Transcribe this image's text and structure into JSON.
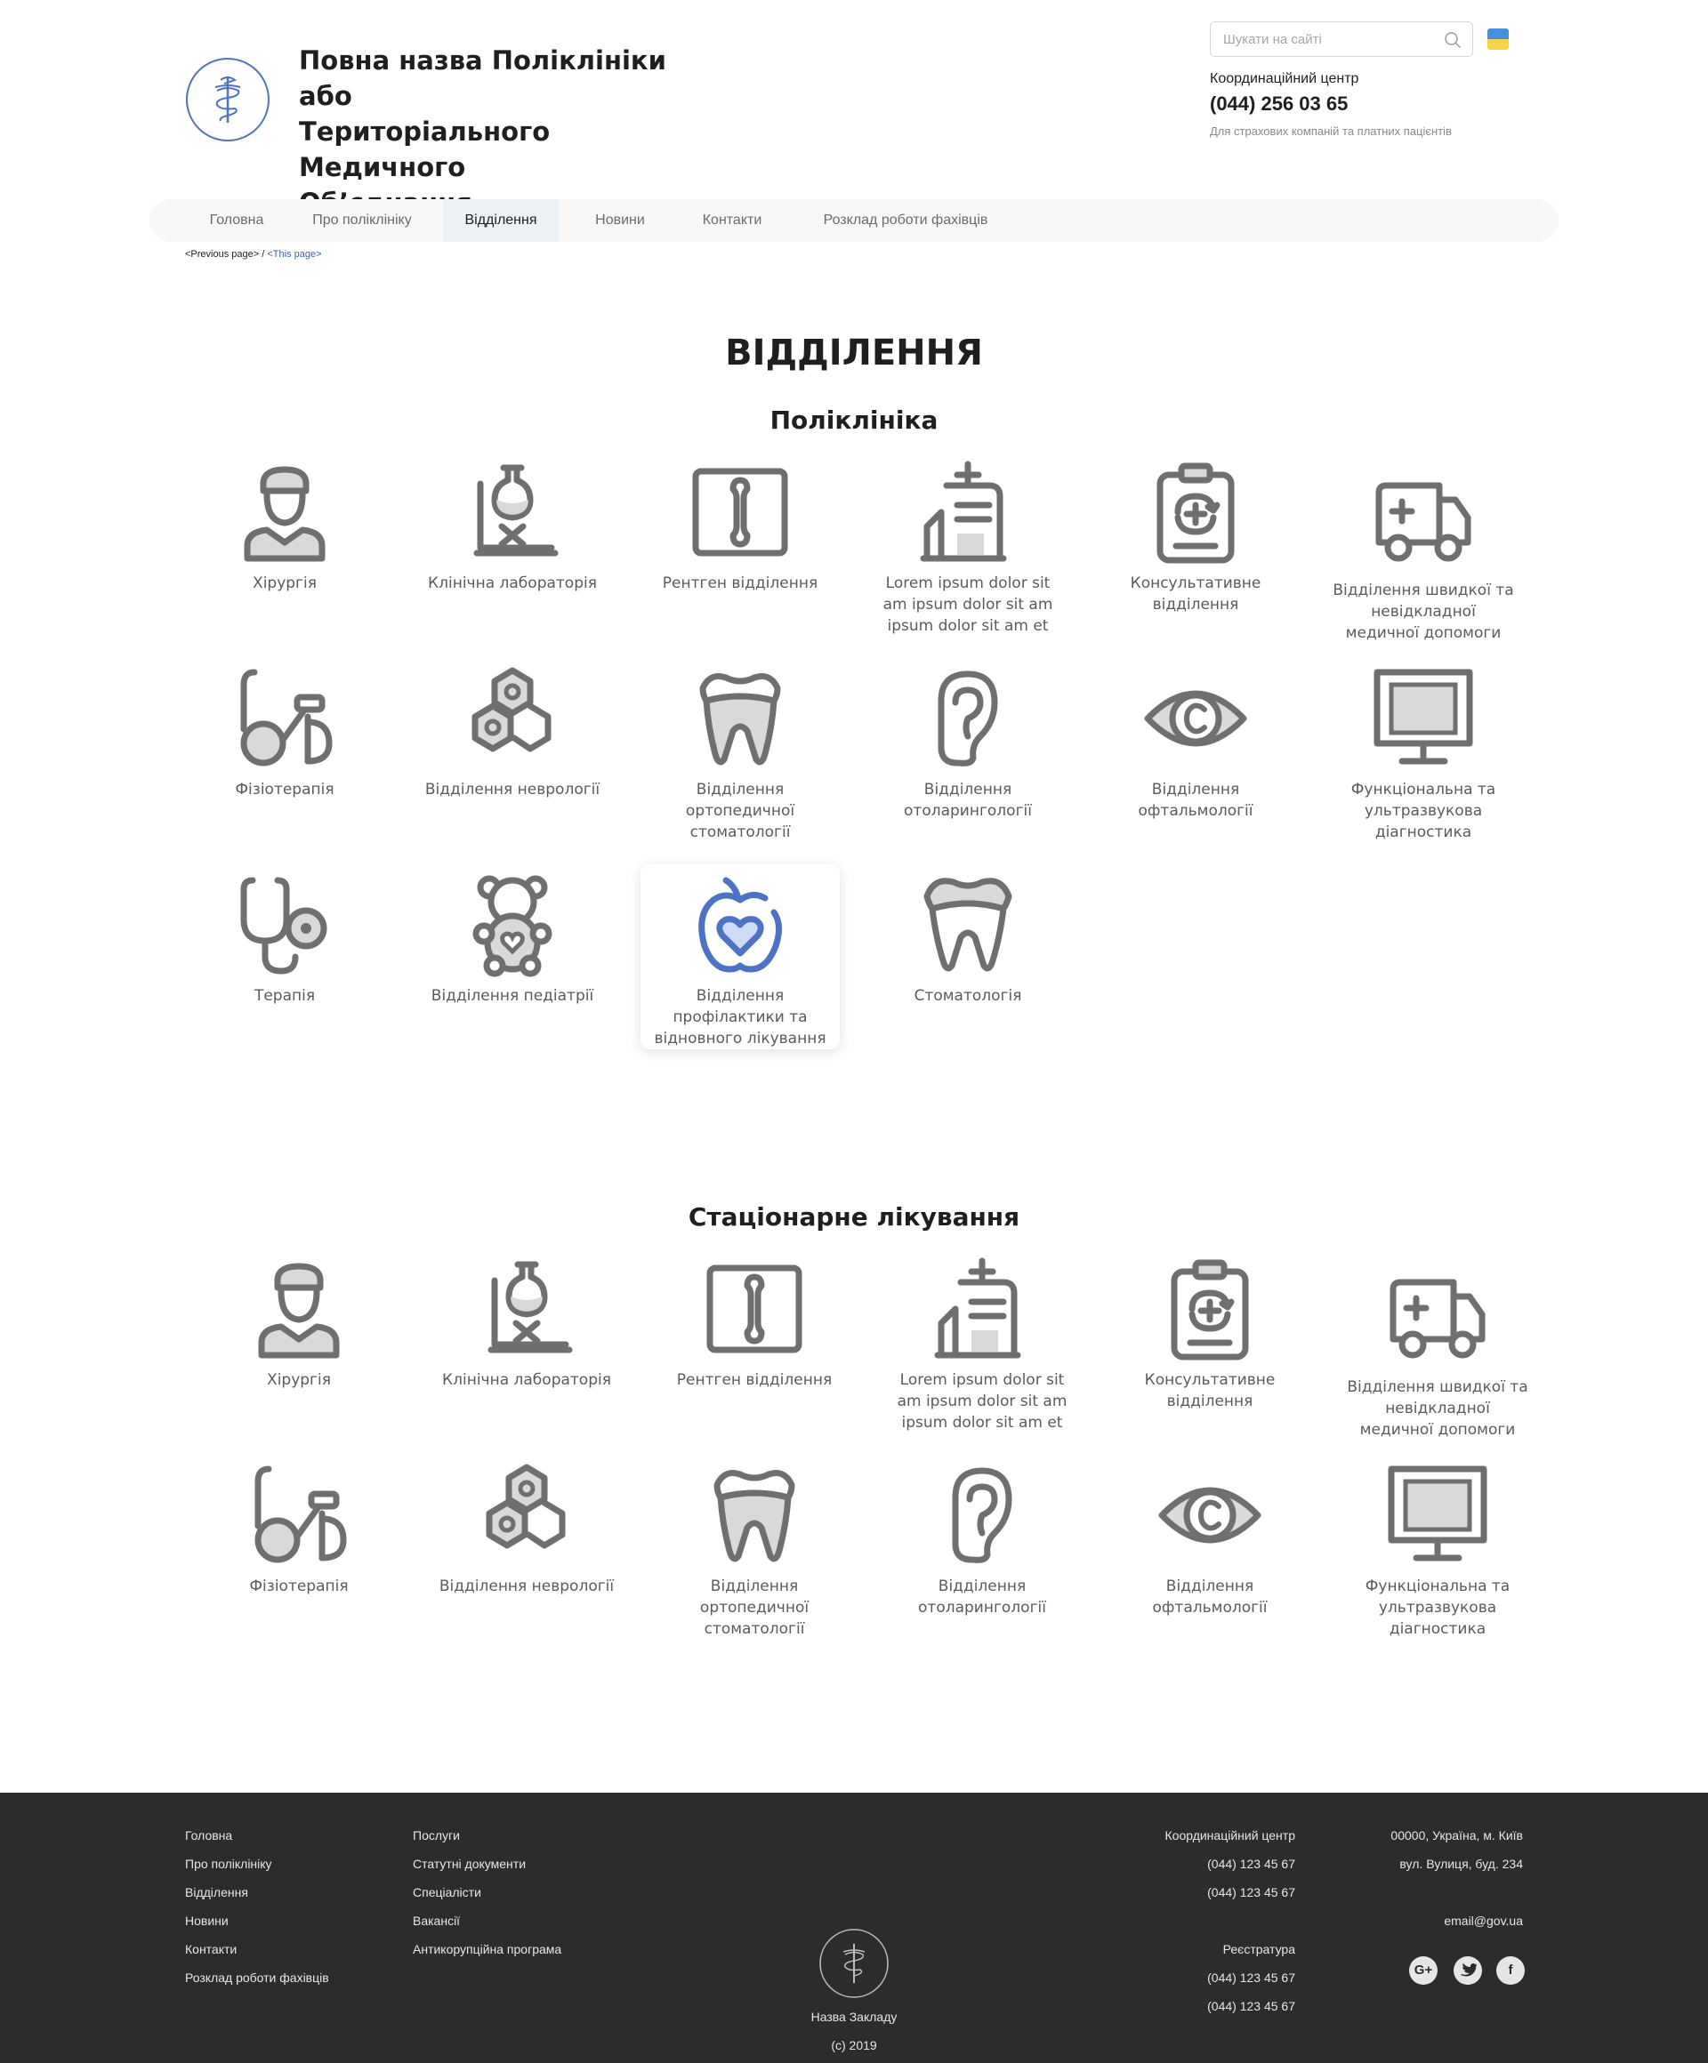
{
  "header": {
    "org_title": "Повна назва Поліклініки або\nТериторіального Медичного\nОб’єднання",
    "search_placeholder": "Шукати на сайті",
    "contact_title": "Координаційний центр",
    "contact_phone": "(044) 256 03 65",
    "contact_note": "Для страхових компаній та платних пацієнтів",
    "flag_colors": [
      "#4a8fdb",
      "#f5d547"
    ]
  },
  "nav": {
    "items": [
      "Головна",
      "Про поліклініку",
      "Відділення",
      "Новини",
      "Контакти",
      "Розклад роботи фахівців"
    ],
    "active": "Відділення"
  },
  "breadcrumb": {
    "previous": "<Previous page>",
    "separator": " / ",
    "current": "<This page>"
  },
  "page_title": "ВІДДІЛЕННЯ",
  "sections": [
    {
      "title": "Поліклініка",
      "departments": [
        {
          "icon": "surgeon-icon",
          "label": "Хірургія"
        },
        {
          "icon": "lab-flask-icon",
          "label": "Клінічна лабораторія"
        },
        {
          "icon": "xray-bone-icon",
          "label": "Рентген відділення"
        },
        {
          "icon": "medical-clipboard-icon",
          "label": "Lorem ipsum dolor sit am  ipsum dolor sit am ipsum dolor sit am et"
        },
        {
          "icon": "consultation-clipboard-icon",
          "label": "Консультативне відділення"
        },
        {
          "icon": "ambulance-icon",
          "label": "Відділення швидкої та невідкладної медичної допомоги"
        },
        {
          "icon": "exercise-bike-icon",
          "label": "Фізіотерапія"
        },
        {
          "icon": "molecule-icon",
          "label": "Відділення неврології"
        },
        {
          "icon": "tooth-crown-icon",
          "label": "Відділення ортопедичної стоматології"
        },
        {
          "icon": "ear-icon",
          "label": "Відділення отоларингології"
        },
        {
          "icon": "eye-icon",
          "label": "Відділення офтальмології"
        },
        {
          "icon": "monitor-icon",
          "label": "Функціональна та ультразвукова діагностика"
        },
        {
          "icon": "stethoscope-icon",
          "label": "Терапія"
        },
        {
          "icon": "teddy-bear-icon",
          "label": "Відділення педіатрії"
        },
        {
          "icon": "apple-heart-icon",
          "label": "Відділення профілактики та відновного лікування",
          "highlighted": true
        },
        {
          "icon": "tooth-icon",
          "label": "Стоматологія"
        }
      ]
    },
    {
      "title": "Стаціонарне лікування",
      "departments": [
        {
          "icon": "surgeon-icon",
          "label": "Хірургія"
        },
        {
          "icon": "lab-flask-icon",
          "label": "Клінічна лабораторія"
        },
        {
          "icon": "xray-bone-icon",
          "label": "Рентген відділення"
        },
        {
          "icon": "medical-clipboard-icon",
          "label": "Lorem ipsum dolor sit am  ipsum dolor sit am ipsum dolor sit am et"
        },
        {
          "icon": "consultation-clipboard-icon",
          "label": "Консультативне відділення"
        },
        {
          "icon": "ambulance-icon",
          "label": "Відділення швидкої та невідкладної медичної допомоги"
        },
        {
          "icon": "exercise-bike-icon",
          "label": "Фізіотерапія"
        },
        {
          "icon": "molecule-icon",
          "label": "Відділення неврології"
        },
        {
          "icon": "tooth-crown-icon",
          "label": "Відділення ортопедичної стоматології"
        },
        {
          "icon": "ear-icon",
          "label": "Відділення отоларингології"
        },
        {
          "icon": "eye-icon",
          "label": "Відділення офтальмології"
        },
        {
          "icon": "monitor-icon",
          "label": "Функціональна та ультразвукова діагностика"
        }
      ]
    }
  ],
  "footer": {
    "col1": [
      "Головна",
      "Про поліклініку",
      "Відділення",
      "Новини",
      "Контакти",
      "Розклад роботи фахівців"
    ],
    "col2": [
      "Послуги",
      "Статутні документи",
      "Спеціалісти",
      "Вакансії",
      "Антикорупційна програма"
    ],
    "coord_title": "Координаційний центр",
    "coord_phones": [
      "(044) 123 45 67",
      "(044) 123 45 67"
    ],
    "reg_title": "Реєстратура",
    "reg_phones": [
      "(044) 123 45 67",
      "(044) 123 45 67"
    ],
    "address": [
      "00000, Україна, м. Київ",
      "вул. Вулиця, буд. 234"
    ],
    "email": "email@gov.ua",
    "institution_name": "Назва Закладу",
    "copyright": "(c) 2019",
    "social": [
      "google-plus-icon",
      "twitter-icon",
      "facebook-icon"
    ]
  },
  "colors": {
    "icon_gray": "#6f6f6f",
    "icon_fill": "#d9d9d9",
    "accent_blue": "#4e72c4",
    "accent_light": "#cfdcf5",
    "footer_bg": "#2c2c2c"
  }
}
